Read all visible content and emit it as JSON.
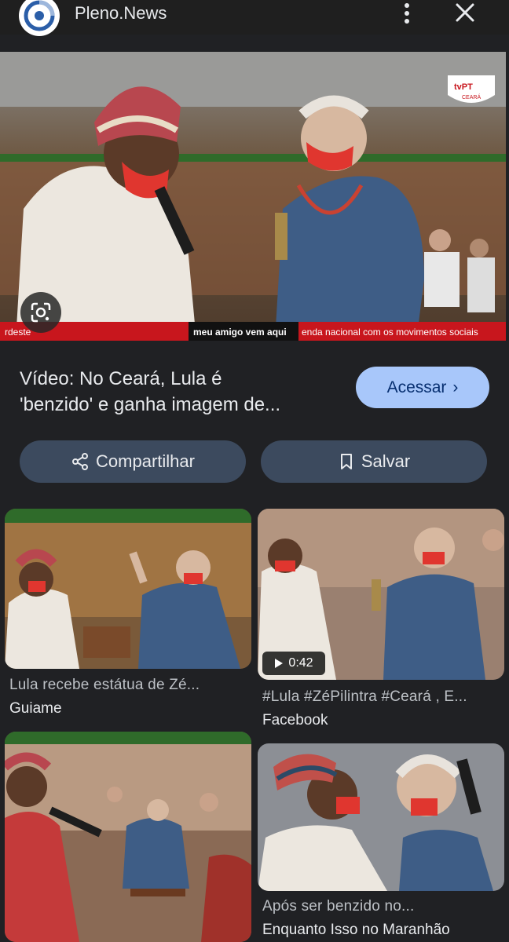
{
  "header": {
    "site_name": "Pleno.News",
    "logo_icon": "pleno-news-logo",
    "more_icon": "more-vert-icon",
    "close_icon": "close-icon"
  },
  "hero": {
    "broadcaster_logo": "tvPT CEARÁ",
    "broadcaster_line1": "tvPT",
    "broadcaster_line2": "CEARÁ",
    "ticker_left": "rdeste",
    "ticker_middle": "meu amigo vem aqui",
    "ticker_right": "enda nacional com os movimentos sociais",
    "lens_icon": "google-lens-icon"
  },
  "result": {
    "title_line1": "Vídeo: No Ceará, Lula é",
    "title_line2": "'benzido' e ganha imagem de...",
    "access_label": "Acessar",
    "access_chevron": "›"
  },
  "actions": {
    "share_label": "Compartilhar",
    "save_label": "Salvar",
    "share_icon": "share-icon",
    "save_icon": "bookmark-icon"
  },
  "related": [
    {
      "caption": "Lula recebe estátua de Zé...",
      "source": "Guiame"
    },
    {
      "caption": "#Lula #ZéPilintra #Ceará , E...",
      "source": "Facebook",
      "duration": "0:42"
    },
    {
      "caption": "",
      "source": ""
    },
    {
      "caption": "Após ser benzido no...",
      "source": "Enquanto Isso no Maranhão"
    }
  ],
  "colors": {
    "background": "#202124",
    "accent_button": "#a8c7fa",
    "pill_button": "#3c4a5e",
    "ticker_red": "#c8161d"
  }
}
